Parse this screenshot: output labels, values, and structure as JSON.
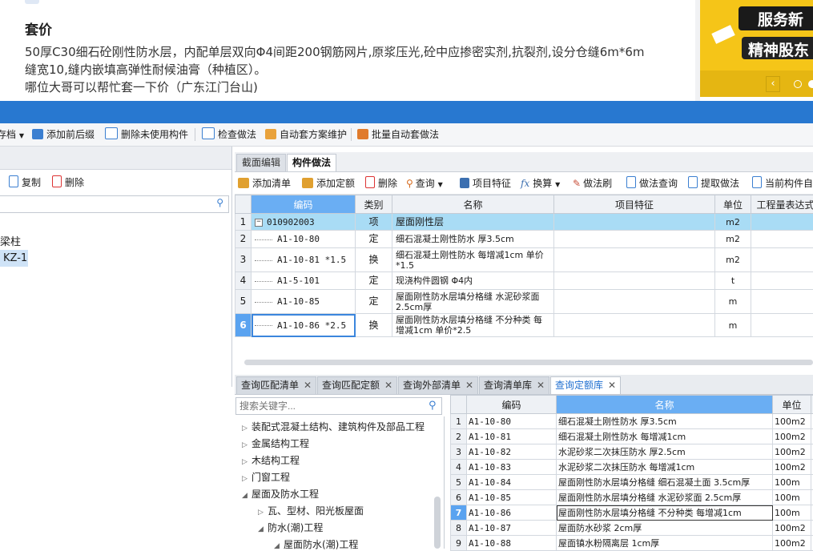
{
  "post": {
    "title": "套价",
    "lines": [
      "50厚C30细石砼刚性防水层，内配单层双向Φ4间距200钢筋网片,原浆压光,砼中应掺密实剂,抗裂剂,设分仓缝6m*6m",
      "缝宽10,缝内嵌填高弹性耐候油膏（种植区）。",
      "哪位大哥可以帮忙套一下价（广东江门台山)"
    ]
  },
  "banner": {
    "line1": "服务新",
    "line2": "精神股东",
    "prev": "‹"
  },
  "main_toolbar": {
    "items": [
      "存档",
      "添加前后缀",
      "删除未使用构件",
      "检查做法",
      "自动套方案维护",
      "批量自动套做法"
    ]
  },
  "left": {
    "tools": {
      "copy": "复制",
      "delete": "删除"
    },
    "tree": {
      "group": "梁柱",
      "selected": "KZ-1"
    }
  },
  "tabs": {
    "section_edit": "截面编辑",
    "component_method": "构件做法"
  },
  "comp_toolbar": {
    "items": [
      "添加清单",
      "添加定额",
      "删除",
      "查询",
      "项目特征",
      "换算",
      "做法刷",
      "做法查询",
      "提取做法",
      "当前构件自"
    ]
  },
  "grid": {
    "headers": [
      "编码",
      "类别",
      "名称",
      "项目特征",
      "单位",
      "工程量表达式"
    ],
    "rows": [
      {
        "no": "1",
        "code": "010902003",
        "cat": "项",
        "name": "屋面刚性层",
        "feature": "",
        "unit": "m2"
      },
      {
        "no": "2",
        "code": "A1-10-80",
        "cat": "定",
        "name": "细石混凝土刚性防水 厚3.5cm",
        "feature": "",
        "unit": "m2"
      },
      {
        "no": "3",
        "code": "A1-10-81 *1.5",
        "cat": "换",
        "name": "细石混凝土刚性防水 每增减1cm  单价*1.5",
        "feature": "",
        "unit": "m2"
      },
      {
        "no": "4",
        "code": "A1-5-101",
        "cat": "定",
        "name": "现浇构件圆钢 Φ4内",
        "feature": "",
        "unit": "t"
      },
      {
        "no": "5",
        "code": "A1-10-85",
        "cat": "定",
        "name": "屋面刚性防水层填分格缝 水泥砂浆面 2.5cm厚",
        "feature": "",
        "unit": "m"
      },
      {
        "no": "6",
        "code": "A1-10-86 *2.5",
        "cat": "换",
        "name": "屋面刚性防水层填分格缝 不分种类 每增减1cm  单价*2.5",
        "feature": "",
        "unit": "m"
      }
    ]
  },
  "bottom_tabs": [
    "查询匹配清单",
    "查询匹配定额",
    "查询外部清单",
    "查询清单库",
    "查询定额库"
  ],
  "search": {
    "placeholder": "搜索关键字..."
  },
  "tree": {
    "nodes": [
      {
        "label": "装配式混凝土结构、建筑构件及部品工程",
        "arrow": "▷"
      },
      {
        "label": "金属结构工程",
        "arrow": "▷"
      },
      {
        "label": "木结构工程",
        "arrow": "▷"
      },
      {
        "label": "门窗工程",
        "arrow": "▷"
      },
      {
        "label": "屋面及防水工程",
        "arrow": "◢"
      },
      {
        "label": "瓦、型材、阳光板屋面",
        "arrow": "▷"
      },
      {
        "label": "防水(潮)工程",
        "arrow": "◢"
      },
      {
        "label": "屋面防水(潮)工程",
        "arrow": "◢"
      }
    ]
  },
  "quota": {
    "headers": [
      "编码",
      "名称",
      "单位"
    ],
    "rows": [
      {
        "no": "1",
        "code": "A1-10-80",
        "name": "细石混凝土刚性防水 厚3.5cm",
        "unit": "100m2"
      },
      {
        "no": "2",
        "code": "A1-10-81",
        "name": "细石混凝土刚性防水 每增减1cm",
        "unit": "100m2"
      },
      {
        "no": "3",
        "code": "A1-10-82",
        "name": "水泥砂浆二次抹压防水 厚2.5cm",
        "unit": "100m2"
      },
      {
        "no": "4",
        "code": "A1-10-83",
        "name": "水泥砂浆二次抹压防水 每增减1cm",
        "unit": "100m2"
      },
      {
        "no": "5",
        "code": "A1-10-84",
        "name": "屋面刚性防水层填分格缝 细石混凝土面 3.5cm厚",
        "unit": "100m"
      },
      {
        "no": "6",
        "code": "A1-10-85",
        "name": "屋面刚性防水层填分格缝 水泥砂浆面 2.5cm厚",
        "unit": "100m"
      },
      {
        "no": "7",
        "code": "A1-10-86",
        "name": "屋面刚性防水层填分格缝 不分种类 每增减1cm",
        "unit": "100m"
      },
      {
        "no": "8",
        "code": "A1-10-87",
        "name": "屋面防水砂浆 2cm厚",
        "unit": "100m2"
      },
      {
        "no": "9",
        "code": "A1-10-88",
        "name": "屋面镇水粉隔离层 1cm厚",
        "unit": "100m2"
      }
    ]
  }
}
